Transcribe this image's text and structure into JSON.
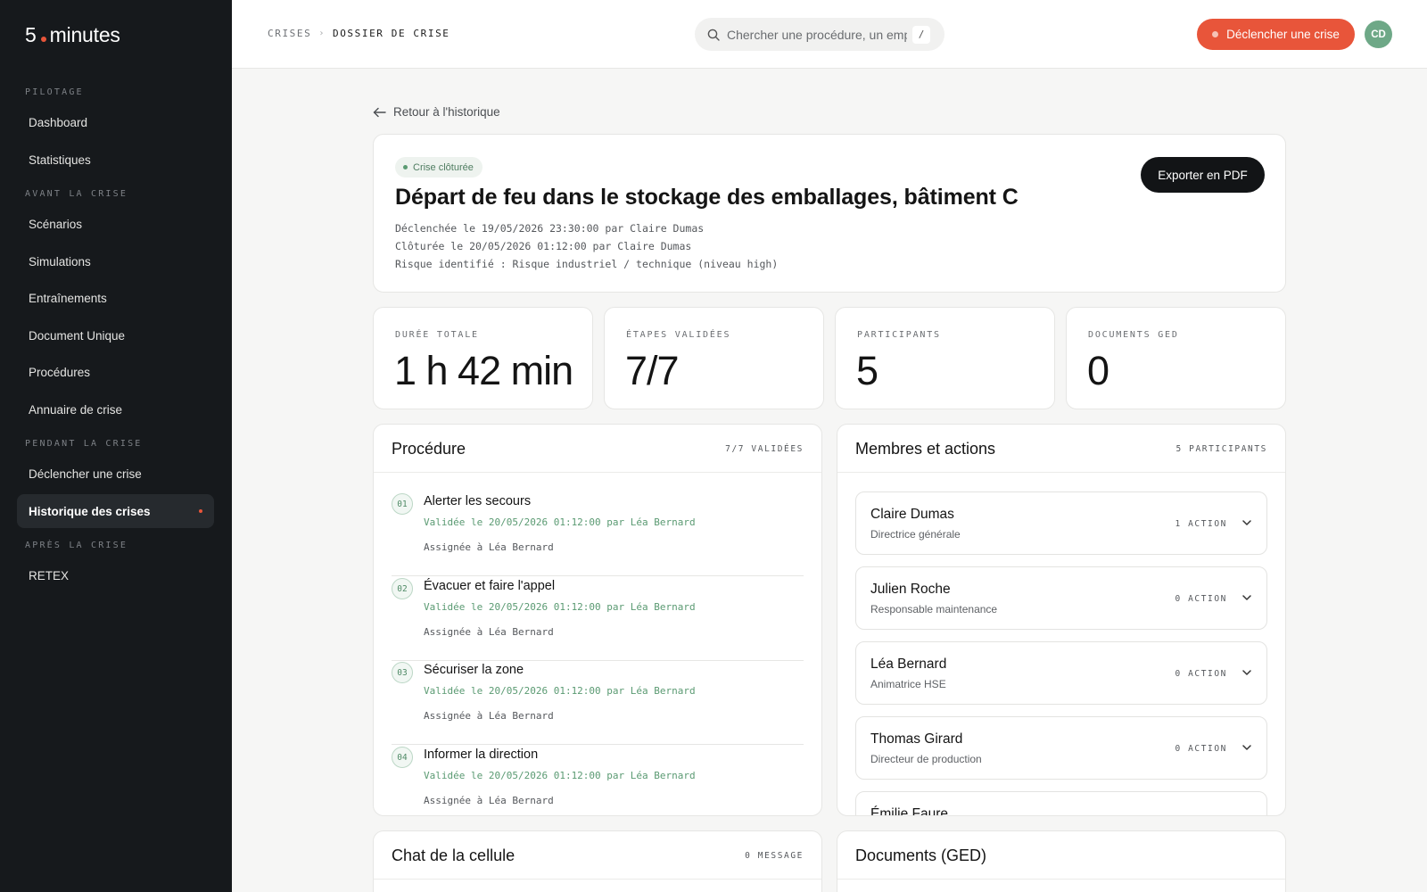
{
  "app": {
    "logo_number": "5",
    "logo_word": "minutes"
  },
  "sidebar": {
    "sections": [
      {
        "label": "PILOTAGE"
      },
      {
        "label": "AVANT LA CRISE"
      },
      {
        "label": "PENDANT LA CRISE"
      },
      {
        "label": "APRÈS LA CRISE"
      }
    ],
    "items": [
      {
        "label": "Dashboard"
      },
      {
        "label": "Statistiques"
      },
      {
        "label": "Scénarios"
      },
      {
        "label": "Simulations"
      },
      {
        "label": "Entraînements"
      },
      {
        "label": "Document Unique"
      },
      {
        "label": "Procédures"
      },
      {
        "label": "Annuaire de crise"
      },
      {
        "label": "Déclencher une crise"
      },
      {
        "label": "Historique des crises",
        "active": true
      },
      {
        "label": "RETEX"
      }
    ]
  },
  "topbar": {
    "breadcrumb": [
      "CRISES",
      "DOSSIER DE CRISE"
    ],
    "breadcrumb_separator": "›",
    "search_placeholder": "Chercher une procédure, un emploi",
    "search_shortcut": "/",
    "declare_button": "Déclencher une crise",
    "avatar_initials": "CD"
  },
  "back_link": "Retour à l'historique",
  "crisis": {
    "status": "Crise clôturée",
    "title": "Départ de feu dans le stockage des emballages, bâtiment C",
    "meta": [
      "Déclenchée le 19/05/2026 23:30:00 par Claire Dumas",
      "Clôturée le 20/05/2026 01:12:00 par Claire Dumas",
      "Risque identifié : Risque industriel / technique (niveau high)"
    ],
    "export_button": "Exporter en PDF"
  },
  "stats": [
    {
      "label": "DURÉE TOTALE",
      "value": "1 h 42 min"
    },
    {
      "label": "ÉTAPES VALIDÉES",
      "value": "7/7"
    },
    {
      "label": "PARTICIPANTS",
      "value": "5"
    },
    {
      "label": "DOCUMENTS GED",
      "value": "0"
    }
  ],
  "procedure": {
    "title": "Procédure",
    "count": "7/7 VALIDÉES",
    "steps": [
      {
        "num": "01",
        "title": "Alerter les secours",
        "validated": "Validée le 20/05/2026 01:12:00 par Léa Bernard",
        "assigned": "Assignée à Léa Bernard"
      },
      {
        "num": "02",
        "title": "Évacuer et faire l'appel",
        "validated": "Validée le 20/05/2026 01:12:00 par Léa Bernard",
        "assigned": "Assignée à Léa Bernard"
      },
      {
        "num": "03",
        "title": "Sécuriser la zone",
        "validated": "Validée le 20/05/2026 01:12:00 par Léa Bernard",
        "assigned": "Assignée à Léa Bernard"
      },
      {
        "num": "04",
        "title": "Informer la direction",
        "validated": "Validée le 20/05/2026 01:12:00 par Léa Bernard",
        "assigned": "Assignée à Léa Bernard"
      }
    ]
  },
  "members": {
    "title": "Membres et actions",
    "count": "5 PARTICIPANTS",
    "list": [
      {
        "name": "Claire Dumas",
        "role": "Directrice générale",
        "actions": "1 ACTION"
      },
      {
        "name": "Julien Roche",
        "role": "Responsable maintenance",
        "actions": "0 ACTION"
      },
      {
        "name": "Léa Bernard",
        "role": "Animatrice HSE",
        "actions": "0 ACTION"
      },
      {
        "name": "Thomas Girard",
        "role": "Directeur de production",
        "actions": "0 ACTION"
      },
      {
        "name": "Émilie Faure",
        "role": "",
        "actions": ""
      }
    ]
  },
  "chat": {
    "title": "Chat de la cellule",
    "count": "0 MESSAGE"
  },
  "documents": {
    "title": "Documents (GED)"
  },
  "colors": {
    "accent": "#e8553a",
    "sidebar_bg": "#16191c",
    "success": "#5a9a72",
    "avatar_bg": "#6ea887"
  }
}
